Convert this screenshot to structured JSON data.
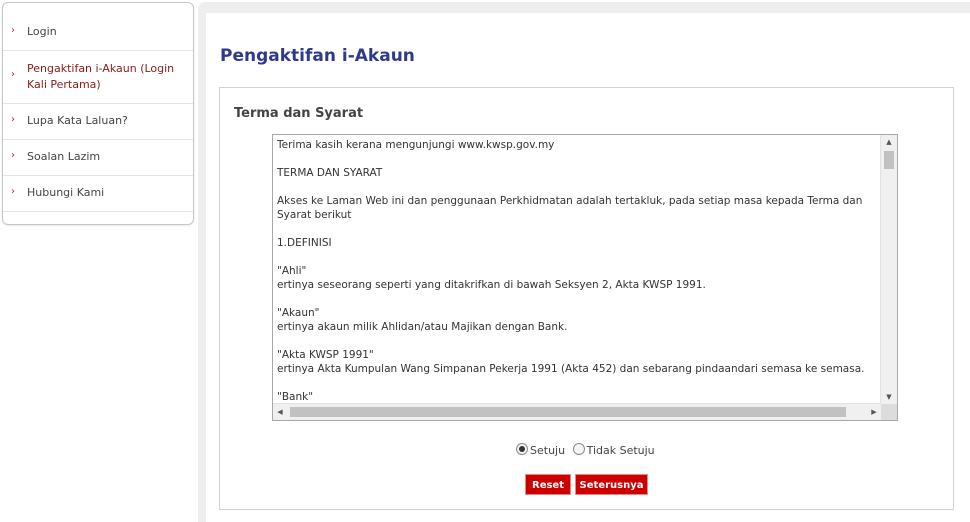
{
  "sidebar": {
    "items": [
      {
        "label": "Login"
      },
      {
        "label": "Pengaktifan i-Akaun (Login Kali Pertama)"
      },
      {
        "label": "Lupa Kata Laluan?"
      },
      {
        "label": "Soalan Lazim"
      },
      {
        "label": "Hubungi Kami"
      }
    ]
  },
  "page": {
    "title": "Pengaktifan i-Akaun",
    "section_title": "Terma dan Syarat"
  },
  "terms": {
    "text": "Terima kasih kerana mengunjungi www.kwsp.gov.my\n\nTERMA DAN SYARAT\n\nAkses ke Laman Web ini dan penggunaan Perkhidmatan adalah tertakluk, pada setiap masa kepada Terma dan Syarat berikut\n\n1.DEFINISI\n\n\"Ahli\"\nertinya seseorang seperti yang ditakrifkan di bawah Seksyen 2, Akta KWSP 1991.\n\n\"Akaun\"\nertinya akaun milik Ahlidan/atau Majikan dengan Bank.\n\n\"Akta KWSP 1991\"\nertinya Akta Kumpulan Wang Simpanan Pekerja 1991 (Akta 452) dan sebarang pindaandari semasa ke semasa.\n\n\"Bank\""
  },
  "form": {
    "agree_label": "Setuju",
    "disagree_label": "Tidak Setuju",
    "agree_selected": true,
    "reset_label": "Reset",
    "next_label": "Seterusnya"
  },
  "colors": {
    "title": "#2e3b8a",
    "button": "#cc0000",
    "active_link": "#8b1a1a"
  }
}
